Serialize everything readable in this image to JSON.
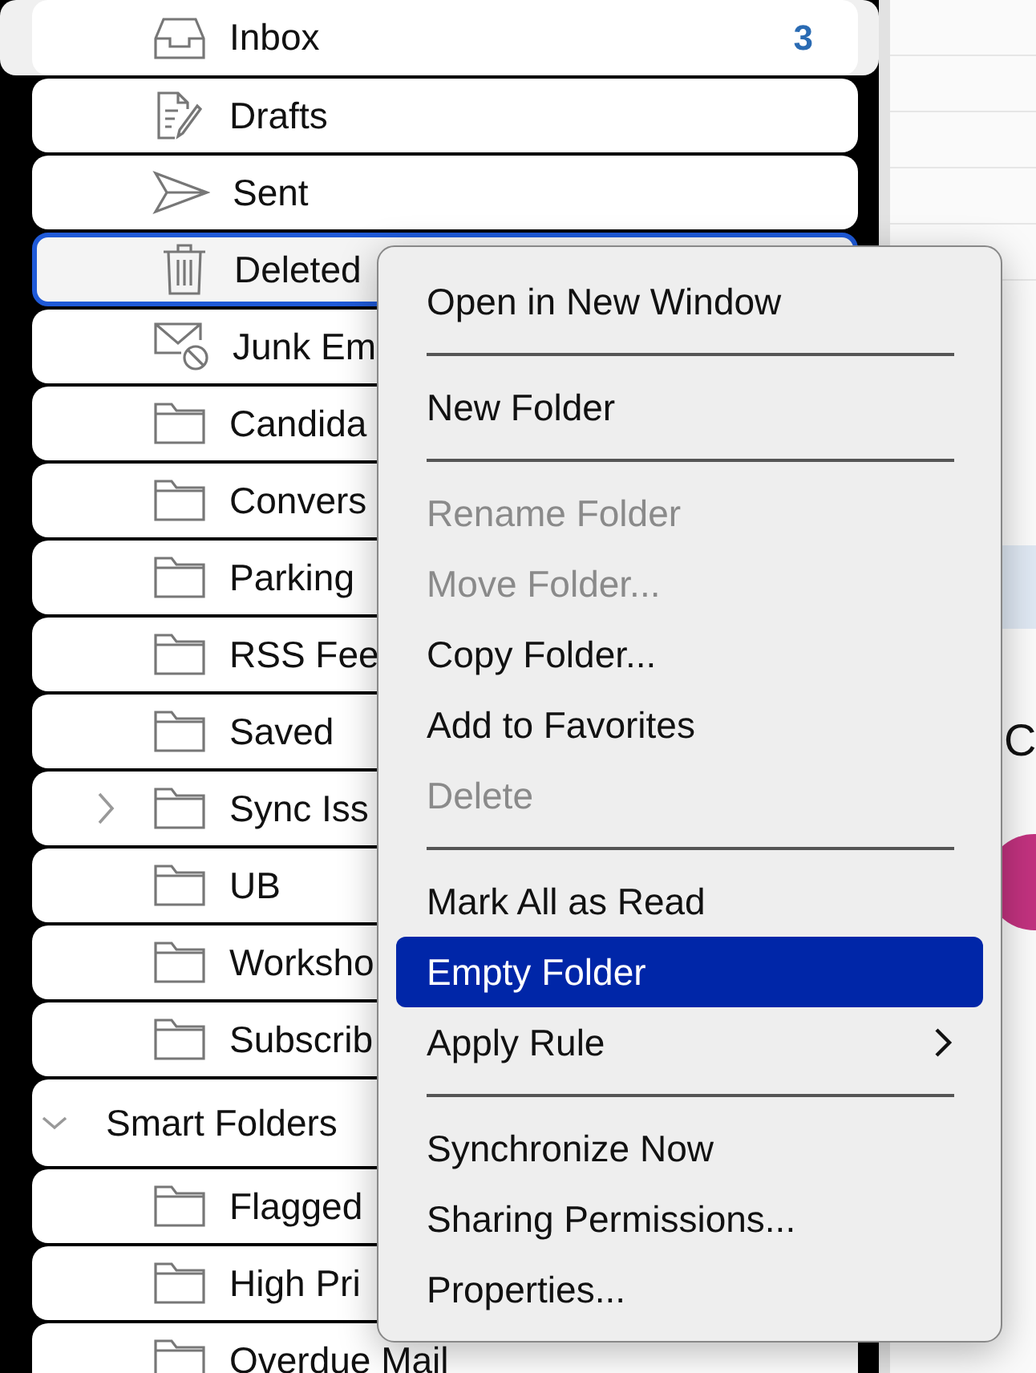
{
  "sidebar": {
    "items": [
      {
        "kind": "inbox",
        "label": "Inbox",
        "count": "3",
        "selected": false
      },
      {
        "kind": "drafts",
        "label": "Drafts",
        "selected": false
      },
      {
        "kind": "sent",
        "label": "Sent",
        "selected": false
      },
      {
        "kind": "trash",
        "label": "Deleted",
        "selected": true
      },
      {
        "kind": "junk",
        "label": "Junk Em",
        "selected": false
      },
      {
        "kind": "folder",
        "label": "Candida",
        "selected": false
      },
      {
        "kind": "folder",
        "label": "Convers",
        "selected": false
      },
      {
        "kind": "folder",
        "label": "Parking",
        "selected": false
      },
      {
        "kind": "folder",
        "label": "RSS Fee",
        "selected": false
      },
      {
        "kind": "folder",
        "label": "Saved",
        "selected": false
      },
      {
        "kind": "folder",
        "label": "Sync Iss",
        "selected": false,
        "expanded": false
      },
      {
        "kind": "folder",
        "label": "UB",
        "selected": false
      },
      {
        "kind": "folder",
        "label": "Worksho",
        "selected": false
      },
      {
        "kind": "folder",
        "label": "Subscrib",
        "selected": false
      },
      {
        "kind": "group",
        "label": "Smart Folders",
        "expanded": true
      },
      {
        "kind": "folder",
        "label": "Flagged",
        "selected": false
      },
      {
        "kind": "folder",
        "label": "High Pri",
        "selected": false
      },
      {
        "kind": "folder",
        "label": "Overdue Mail",
        "selected": false
      }
    ]
  },
  "reading_pane": {
    "heading_fragment": "C"
  },
  "context_menu": {
    "items": [
      {
        "kind": "item",
        "label": "Open in New Window",
        "disabled": false,
        "selected": false
      },
      {
        "kind": "separator"
      },
      {
        "kind": "item",
        "label": "New Folder",
        "disabled": false,
        "selected": false
      },
      {
        "kind": "separator"
      },
      {
        "kind": "item",
        "label": "Rename Folder",
        "disabled": true,
        "selected": false
      },
      {
        "kind": "item",
        "label": "Move Folder...",
        "disabled": true,
        "selected": false
      },
      {
        "kind": "item",
        "label": "Copy Folder...",
        "disabled": false,
        "selected": false
      },
      {
        "kind": "item",
        "label": "Add to Favorites",
        "disabled": false,
        "selected": false
      },
      {
        "kind": "item",
        "label": "Delete",
        "disabled": true,
        "selected": false
      },
      {
        "kind": "separator"
      },
      {
        "kind": "item",
        "label": "Mark All as Read",
        "disabled": false,
        "selected": false
      },
      {
        "kind": "item",
        "label": "Empty Folder",
        "disabled": false,
        "selected": true
      },
      {
        "kind": "submenu",
        "label": "Apply Rule",
        "disabled": false,
        "selected": false
      },
      {
        "kind": "separator"
      },
      {
        "kind": "item",
        "label": "Synchronize Now",
        "disabled": false,
        "selected": false
      },
      {
        "kind": "item",
        "label": "Sharing Permissions...",
        "disabled": false,
        "selected": false
      },
      {
        "kind": "item",
        "label": "Properties...",
        "disabled": false,
        "selected": false
      }
    ]
  }
}
